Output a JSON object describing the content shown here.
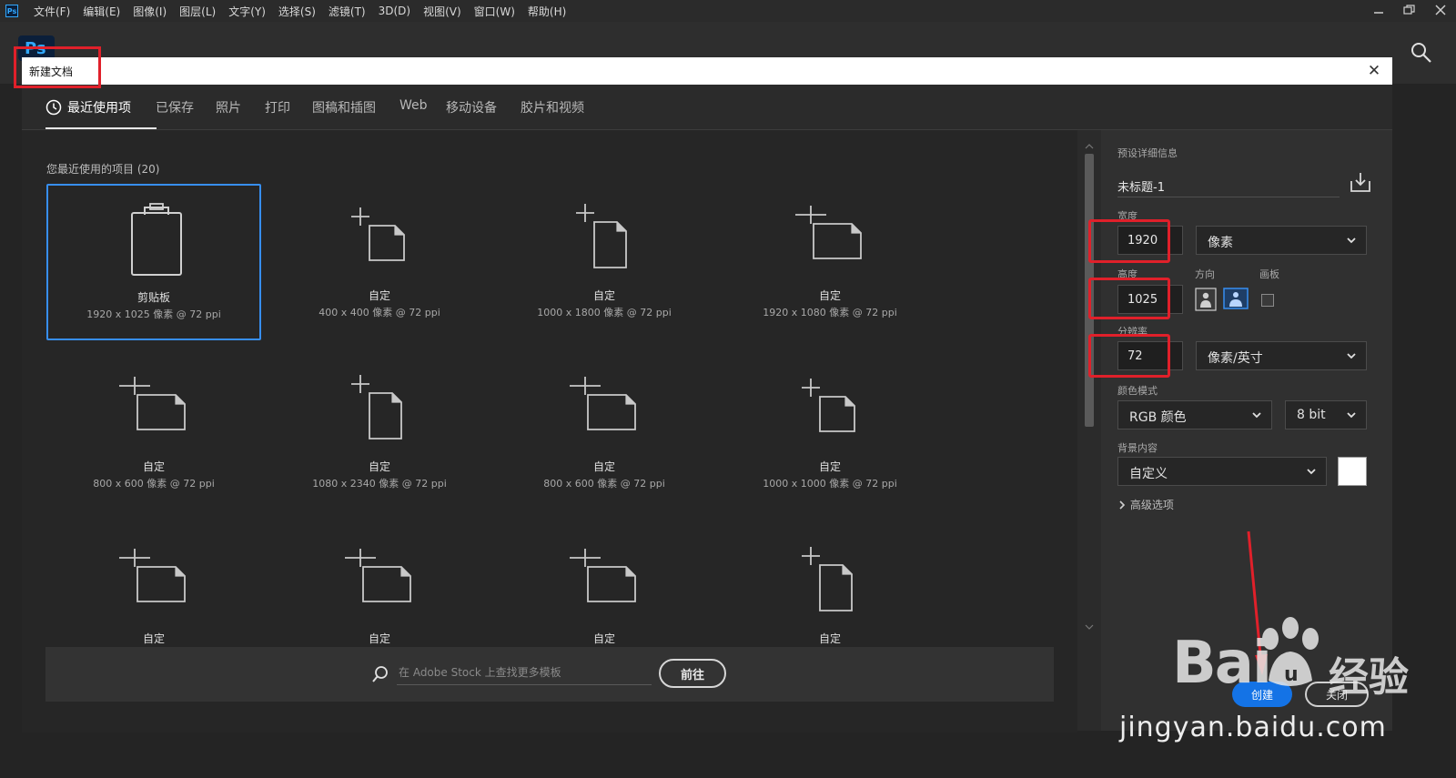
{
  "menubar": {
    "app_icon": "Ps",
    "items": [
      "文件(F)",
      "编辑(E)",
      "图像(I)",
      "图层(L)",
      "文字(Y)",
      "选择(S)",
      "滤镜(T)",
      "3D(D)",
      "视图(V)",
      "窗口(W)",
      "帮助(H)"
    ],
    "window_controls": [
      "minimize-icon",
      "restore-icon",
      "close-icon"
    ]
  },
  "home": {
    "logo": "Ps",
    "search_icon": "search-icon"
  },
  "dialog": {
    "title": "新建文档",
    "close_glyph": "✕",
    "tabs": [
      {
        "label": "最近使用项",
        "active": true
      },
      {
        "label": "已保存"
      },
      {
        "label": "照片"
      },
      {
        "label": "打印"
      },
      {
        "label": "图稿和插图"
      },
      {
        "label": "Web"
      },
      {
        "label": "移动设备"
      },
      {
        "label": "胶片和视频"
      }
    ],
    "recent_label": "您最近使用的项目",
    "recent_count": "(20)",
    "presets": [
      {
        "name": "剪贴板",
        "dims": "1920 x 1025 像素 @ 72 ppi",
        "icon": "clipboard-icon",
        "selected": true
      },
      {
        "name": "自定",
        "dims": "400 x 400 像素 @ 72 ppi",
        "icon": "square-document-icon"
      },
      {
        "name": "自定",
        "dims": "1000 x 1800 像素 @ 72 ppi",
        "icon": "portrait-document-icon"
      },
      {
        "name": "自定",
        "dims": "1920 x 1080 像素 @ 72 ppi",
        "icon": "landscape-document-icon"
      },
      {
        "name": "自定",
        "dims": "800 x 600 像素 @ 72 ppi",
        "icon": "landscape-document-icon"
      },
      {
        "name": "自定",
        "dims": "1080 x 2340 像素 @ 72 ppi",
        "icon": "portrait-document-icon"
      },
      {
        "name": "自定",
        "dims": "800 x 600 像素 @ 72 ppi",
        "icon": "landscape-document-icon"
      },
      {
        "name": "自定",
        "dims": "1000 x 1000 像素 @ 72 ppi",
        "icon": "square-document-icon"
      },
      {
        "name": "自定",
        "dims": "",
        "icon": "landscape-document-icon"
      },
      {
        "name": "自定",
        "dims": "",
        "icon": "landscape-document-icon"
      },
      {
        "name": "自定",
        "dims": "",
        "icon": "landscape-document-icon"
      },
      {
        "name": "自定",
        "dims": "",
        "icon": "portrait-document-icon"
      }
    ],
    "stock_search": {
      "placeholder": "在 Adobe Stock 上查找更多模板",
      "go_label": "前往"
    },
    "details": {
      "header": "预设详细信息",
      "doc_name": "未标题-1",
      "width_label": "宽度",
      "width_value": "1920",
      "width_unit": "像素",
      "height_label": "高度",
      "height_value": "1025",
      "orientation_label": "方向",
      "artboard_label": "画板",
      "resolution_label": "分辨率",
      "resolution_value": "72",
      "resolution_unit": "像素/英寸",
      "color_mode_label": "颜色模式",
      "color_mode": "RGB 颜色",
      "bit_depth": "8 bit",
      "background_label": "背景内容",
      "background": "自定义",
      "background_color": "#ffffff",
      "advanced": "高级选项",
      "create_label": "创建",
      "close_label": "关闭"
    }
  },
  "watermark": {
    "text": "Bai",
    "cn": "经验",
    "url": "jingyan.baidu.com"
  },
  "colors": {
    "accent": "#378ef0",
    "annotation": "#e0202a",
    "create": "#1473e6"
  }
}
